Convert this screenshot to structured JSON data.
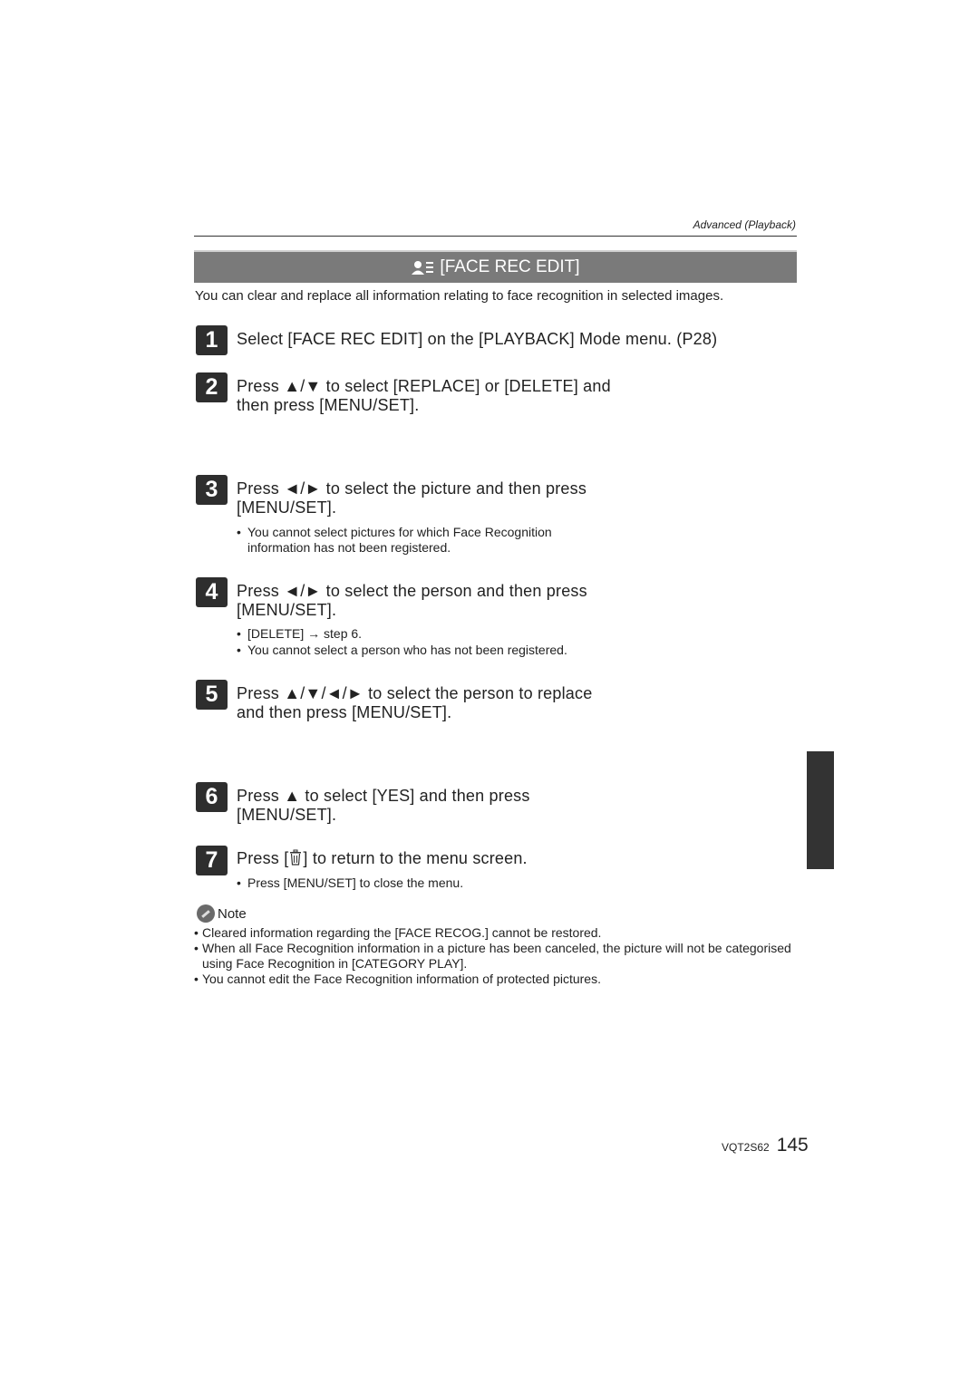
{
  "header": {
    "section_label": "Advanced (Playback)",
    "title": "[FACE REC EDIT]",
    "title_icon": "face-recognition-icon"
  },
  "intro": "You can clear and replace all information relating to face recognition in selected images.",
  "steps": [
    {
      "num": "1",
      "lines": [
        "Select [FACE REC EDIT] on the [PLAYBACK] Mode menu. (P28)"
      ],
      "bullets": []
    },
    {
      "num": "2",
      "lines": [
        "Press ▲/▼ to select [REPLACE] or [DELETE] and",
        "then press [MENU/SET]."
      ],
      "bullets": []
    },
    {
      "num": "3",
      "lines": [
        "Press ◄/► to select the picture and then press",
        "[MENU/SET]."
      ],
      "bullets": [
        "You cannot select pictures for which Face Recognition",
        "information has not been registered."
      ]
    },
    {
      "num": "4",
      "lines": [
        "Press ◄/► to select the person and then press",
        "[MENU/SET]."
      ],
      "bullets": [
        "[DELETE] → step 6.",
        "You cannot select a person who has not been registered."
      ]
    },
    {
      "num": "5",
      "lines": [
        "Press ▲/▼/◄/► to select the person to replace",
        "and then press [MENU/SET]."
      ],
      "bullets": []
    },
    {
      "num": "6",
      "lines": [
        "Press ▲ to select [YES] and then press",
        "[MENU/SET]."
      ],
      "bullets": []
    },
    {
      "num": "7",
      "lines": [
        "Press [",
        "] to return to the menu screen."
      ],
      "icon": "trash-icon",
      "bullets": [
        "Press [MENU/SET] to close the menu."
      ]
    }
  ],
  "note": {
    "label": "Note",
    "items": [
      "Cleared information regarding the [FACE RECOG.] cannot be restored.",
      "When all Face Recognition information in a picture has been canceled, the picture will not be categorised using Face Recognition in [CATEGORY PLAY].",
      "You cannot edit the Face Recognition information of protected pictures."
    ]
  },
  "footer": {
    "code": "VQT2S62",
    "page": "145"
  },
  "colors": {
    "band": "#7a7a7a",
    "step_badge": "#2e2e2e",
    "side_tab": "#333333"
  }
}
